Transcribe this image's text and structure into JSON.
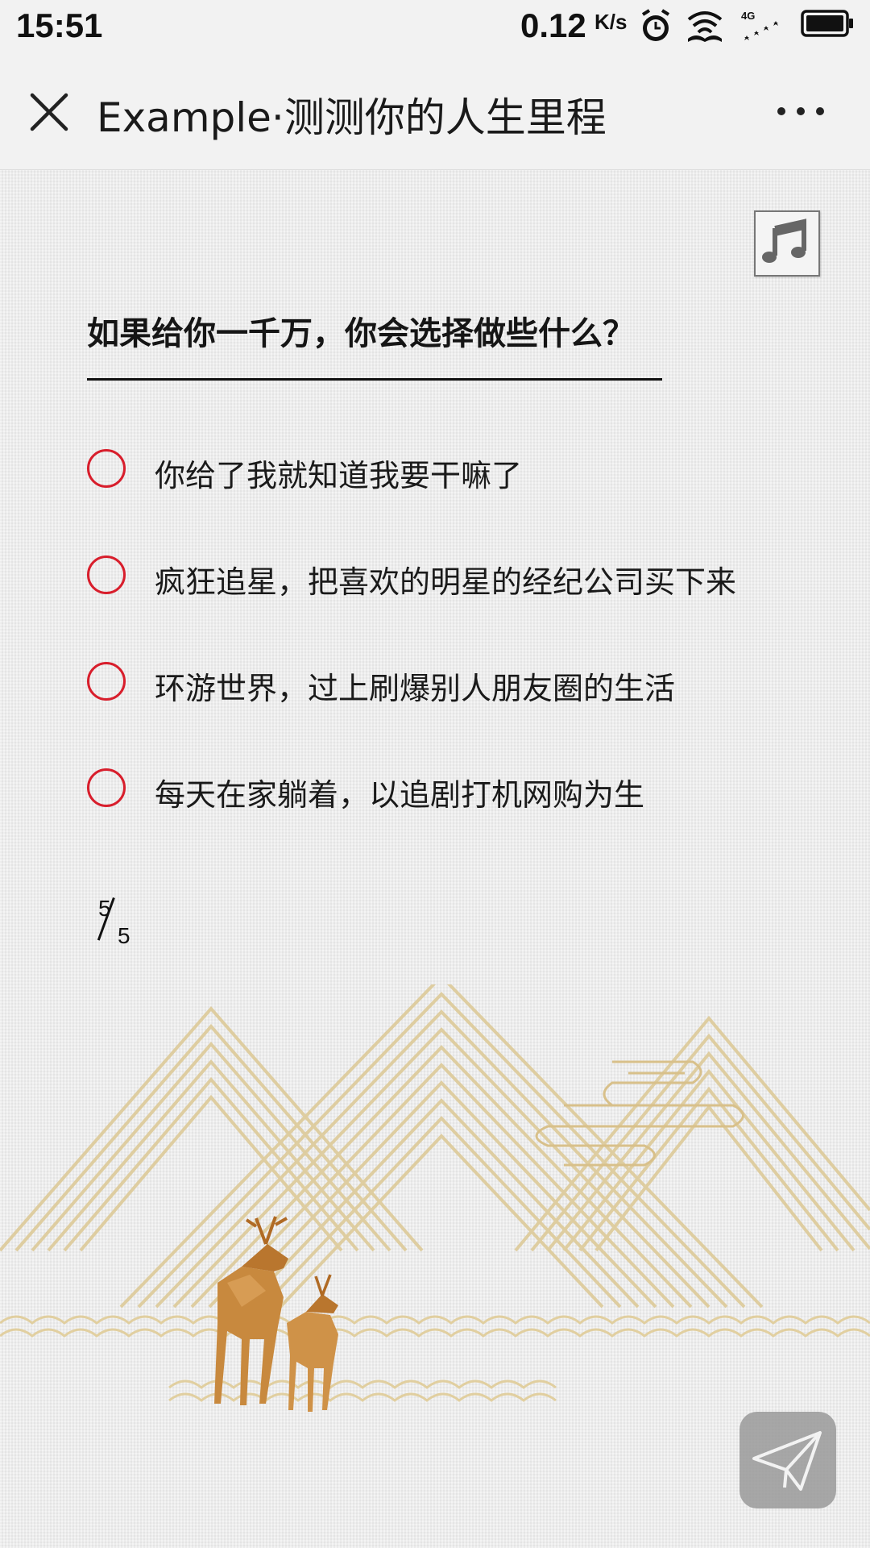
{
  "status_bar": {
    "time": "15:51",
    "speed_value": "0.12",
    "speed_unit": "K/s",
    "icons": [
      "alarm-icon",
      "wifi-icon",
      "signal-4g-icon",
      "battery-icon"
    ],
    "network": "4G"
  },
  "title_bar": {
    "close_icon": "close-icon",
    "title": "Example·测测你的人生里程",
    "more_icon": "more-icon"
  },
  "quiz": {
    "music_icon": "music-note-icon",
    "question": "如果给你一千万，你会选择做些什么？",
    "options": [
      "你给了我就知道我要干嘛了",
      "疯狂追星，把喜欢的明星的经纪公司买下来",
      "环游世界，过上刷爆别人朋友圈的生活",
      "每天在家躺着，以追剧打机网购为生"
    ],
    "progress": {
      "current": "5",
      "total": "5"
    },
    "send_icon": "paper-plane-icon"
  },
  "colors": {
    "radio_border": "#d81e2c",
    "background": "#ececec",
    "mountain_gold": "#dcc894",
    "deer": "#c8893e"
  }
}
